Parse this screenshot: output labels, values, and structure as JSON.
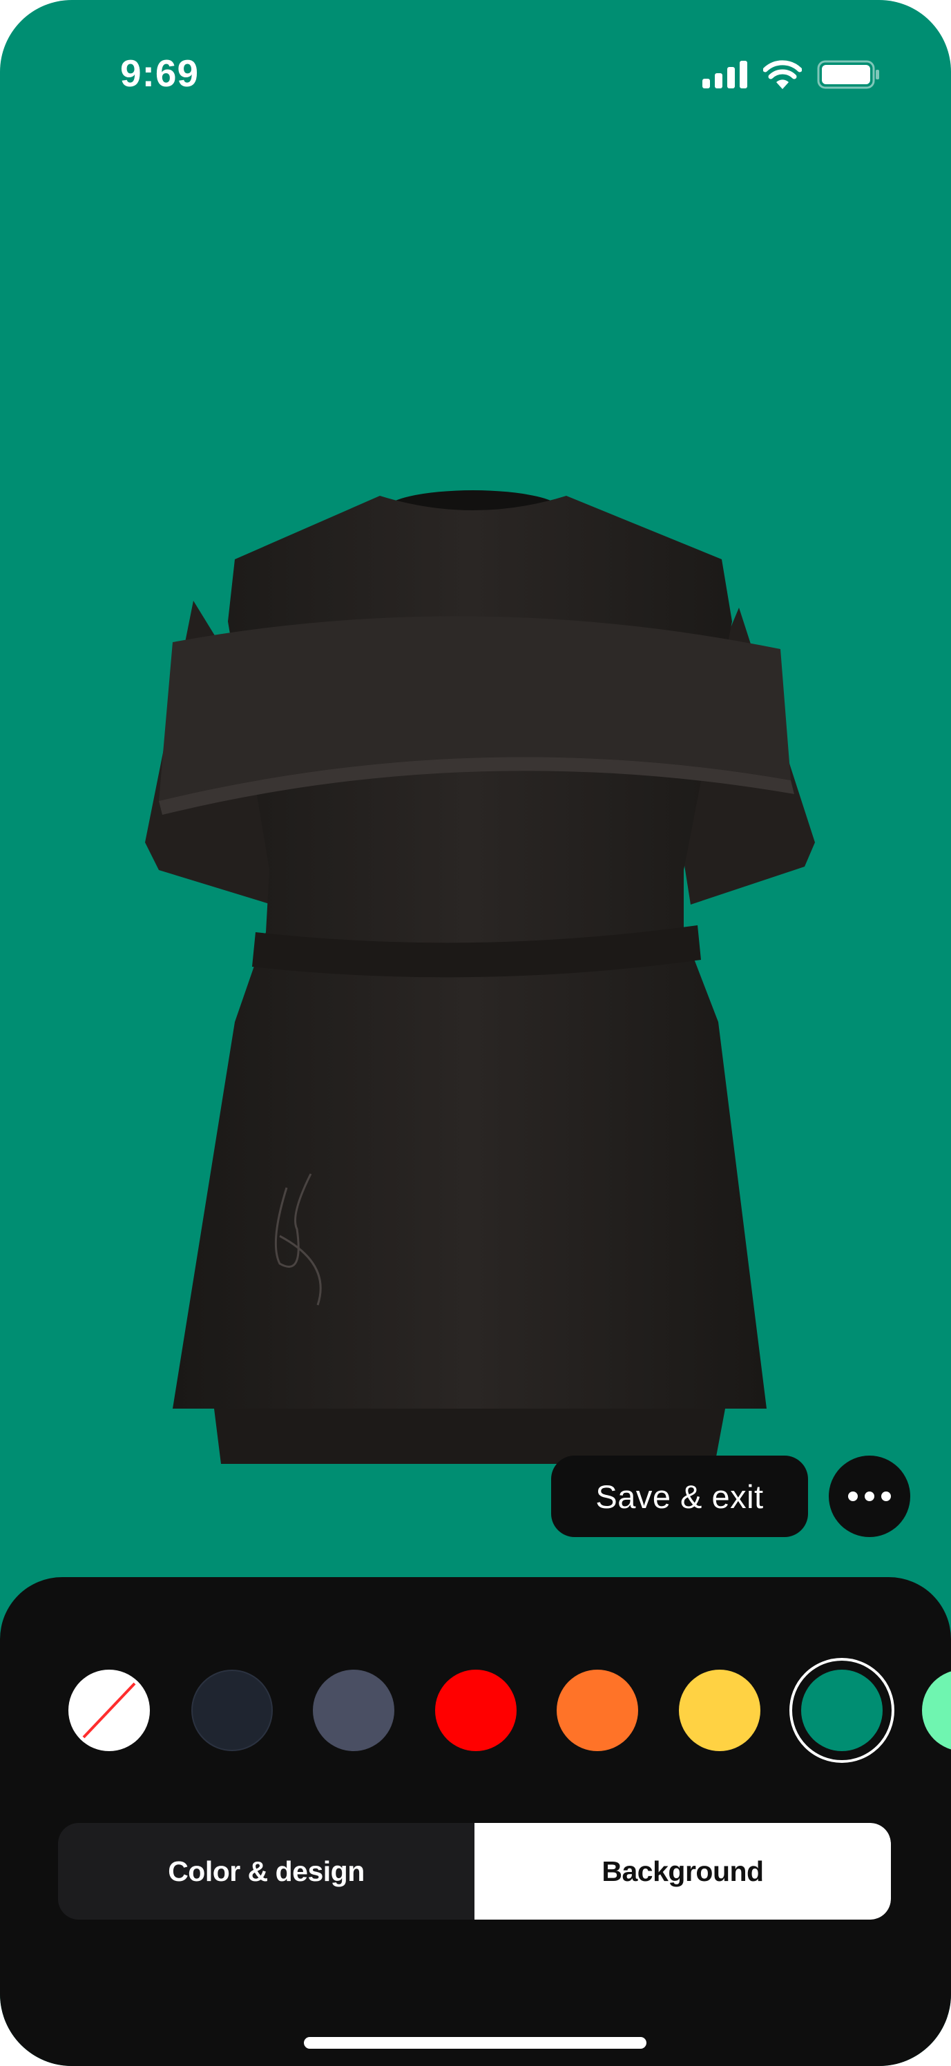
{
  "status_bar": {
    "time": "9:69",
    "icons": [
      "cellular-signal-icon",
      "wifi-icon",
      "battery-icon"
    ]
  },
  "canvas": {
    "background_color": "#008e72",
    "garment": "black t-shirt dress 3D preview"
  },
  "actions": {
    "save_exit_label": "Save & exit",
    "more_icon": "more-dots-icon"
  },
  "color_palette": {
    "swatches": [
      {
        "name": "none",
        "color": "#ffffff",
        "selected": false
      },
      {
        "name": "dark-navy",
        "color": "#1f2530",
        "selected": false
      },
      {
        "name": "slate",
        "color": "#4a4f63",
        "selected": false
      },
      {
        "name": "red",
        "color": "#ff0000",
        "selected": false
      },
      {
        "name": "orange",
        "color": "#ff7328",
        "selected": false
      },
      {
        "name": "yellow",
        "color": "#ffd243",
        "selected": false
      },
      {
        "name": "green",
        "color": "#008e72",
        "selected": true
      },
      {
        "name": "mint",
        "color": "#6ff5b0",
        "selected": false
      }
    ]
  },
  "tabs": [
    {
      "label": "Color & design",
      "active": false
    },
    {
      "label": "Background",
      "active": true
    }
  ]
}
